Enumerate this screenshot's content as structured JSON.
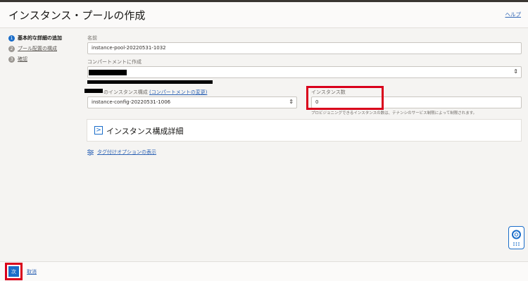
{
  "header": {
    "title": "インスタンス・プールの作成",
    "help_link": "ヘルプ"
  },
  "steps": [
    {
      "num": "1",
      "label": "基本的な詳細の追加"
    },
    {
      "num": "2",
      "label": "プール配置の構成"
    },
    {
      "num": "3",
      "label": "確認"
    }
  ],
  "form": {
    "name_label": "名前",
    "name_value": "instance-pool-20220531-1032",
    "compartment_label": "コンパートメントに作成",
    "config_label_suffix": "のインスタンス構成",
    "config_change_link": "(コンパートメントの変更)",
    "config_value": "instance-config-20220531-1006",
    "count_label": "インスタンス数",
    "count_value": "0",
    "count_help": "プロビジョニングできるインスタンスの数は、テナンシのサービス制限によって制限されます。",
    "config_details_title": "インスタンス構成詳細",
    "tag_options_link": "タグ付けオプションの表示"
  },
  "footer": {
    "next_label": "次",
    "cancel_label": "取消"
  },
  "colors": {
    "accent": "#1a6dc9",
    "link": "#2f64b5",
    "highlight": "#d9001b",
    "background": "#f5f4f2"
  },
  "icons": {
    "expand": "chevron-right-icon",
    "tag_options": "sliders-icon",
    "help_widget": "lifebuoy-icon",
    "select": "chevron-up-down-icon"
  }
}
